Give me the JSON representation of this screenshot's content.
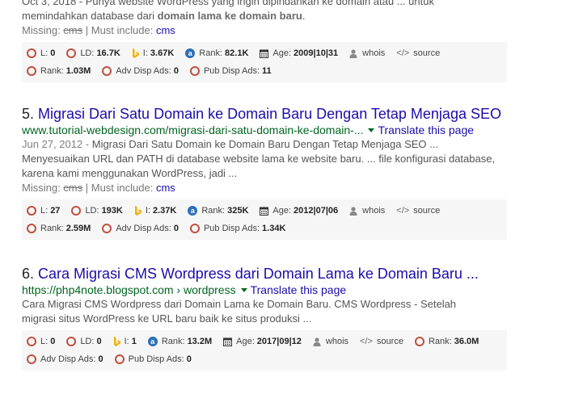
{
  "top": {
    "line1": "Oct 3, 2018 - Punya website WordPress yang ingin dipindahkan ke domain atau ... untuk",
    "line2_pre": "memindahkan database dari ",
    "line2_b1": "domain lama ke domain baru",
    "line2_post": ".",
    "missing_label": "Missing: ",
    "missing_word": "cms",
    "must_label": " | Must include: ",
    "must_word": "cms",
    "seo_row1": [
      {
        "icon": "ring-icon",
        "label": "L:",
        "value": "0"
      },
      {
        "icon": "ring-icon",
        "label": "LD:",
        "value": "16.7K"
      },
      {
        "icon": "bing-icon",
        "label": "I:",
        "value": "3.67K"
      },
      {
        "icon": "alexa-icon",
        "label": "Rank:",
        "value": "82.1K"
      },
      {
        "icon": "calendar-icon",
        "label": "Age:",
        "value": "2009|10|31"
      },
      {
        "icon": "person-icon",
        "label": "whois",
        "value": ""
      },
      {
        "icon": "code-icon",
        "label": "source",
        "value": ""
      }
    ],
    "seo_row2": [
      {
        "icon": "ring-icon",
        "label": "Rank:",
        "value": "1.03M"
      },
      {
        "icon": "ring-icon",
        "label": "Adv Disp Ads:",
        "value": "0"
      },
      {
        "icon": "ring-icon",
        "label": "Pub Disp Ads:",
        "value": "11"
      }
    ]
  },
  "r5": {
    "num": "5.",
    "title": "Migrasi Dari Satu Domain ke Domain Baru Dengan Tetap Menjaga SEO",
    "url": "www.tutorial-webdesign.com/migrasi-dari-satu-domain-ke-domain-...",
    "translate": "Translate this page",
    "date": "Jun 27, 2012 - ",
    "snip1": "Migrasi Dari Satu Domain ke Domain Baru Dengan Tetap Menjaga SEO ...",
    "snip2": "Menyesuaikan URL dan PATH di database website lama ke website baru. ... file konfigurasi database,",
    "snip3": "karena kami menggunakan WordPress, jadi ...",
    "missing_label": "Missing: ",
    "missing_word": "cms",
    "must_label": " | Must include: ",
    "must_word": "cms",
    "seo_row1": [
      {
        "icon": "ring-icon",
        "label": "L:",
        "value": "27"
      },
      {
        "icon": "ring-icon",
        "label": "LD:",
        "value": "193K"
      },
      {
        "icon": "bing-icon",
        "label": "I:",
        "value": "2.37K"
      },
      {
        "icon": "alexa-icon",
        "label": "Rank:",
        "value": "325K"
      },
      {
        "icon": "calendar-icon",
        "label": "Age:",
        "value": "2012|07|06"
      },
      {
        "icon": "person-icon",
        "label": "whois",
        "value": ""
      },
      {
        "icon": "code-icon",
        "label": "source",
        "value": ""
      }
    ],
    "seo_row2": [
      {
        "icon": "ring-icon",
        "label": "Rank:",
        "value": "2.59M"
      },
      {
        "icon": "ring-icon",
        "label": "Adv Disp Ads:",
        "value": "0"
      },
      {
        "icon": "ring-icon",
        "label": "Pub Disp Ads:",
        "value": "1.34K"
      }
    ]
  },
  "r6": {
    "num": "6.",
    "title": "Cara Migrasi CMS Wordpress dari Domain Lama ke Domain Baru ...",
    "url": "https://php4note.blogspot.com › wordpress",
    "translate": "Translate this page",
    "snip1": "Cara Migrasi CMS Wordpress dari Domain Lama ke Domain Baru. CMS Wordpress - Setelah",
    "snip2": "migrasi situs WordPress ke URL baru baik ke situs produksi ...",
    "seo_row1": [
      {
        "icon": "ring-icon",
        "label": "L:",
        "value": "0"
      },
      {
        "icon": "ring-icon",
        "label": "LD:",
        "value": "0"
      },
      {
        "icon": "bing-icon",
        "label": "I:",
        "value": "1"
      },
      {
        "icon": "alexa-icon",
        "label": "Rank:",
        "value": "13.2M"
      },
      {
        "icon": "calendar-icon",
        "label": "Age:",
        "value": "2017|09|12"
      },
      {
        "icon": "person-icon",
        "label": "whois",
        "value": ""
      },
      {
        "icon": "code-icon",
        "label": "source",
        "value": ""
      },
      {
        "icon": "ring-icon",
        "label": "Rank:",
        "value": "36.0M"
      }
    ],
    "seo_row2": [
      {
        "icon": "ring-icon",
        "label": "Adv Disp Ads:",
        "value": "0"
      },
      {
        "icon": "ring-icon",
        "label": "Pub Disp Ads:",
        "value": "0"
      }
    ]
  }
}
